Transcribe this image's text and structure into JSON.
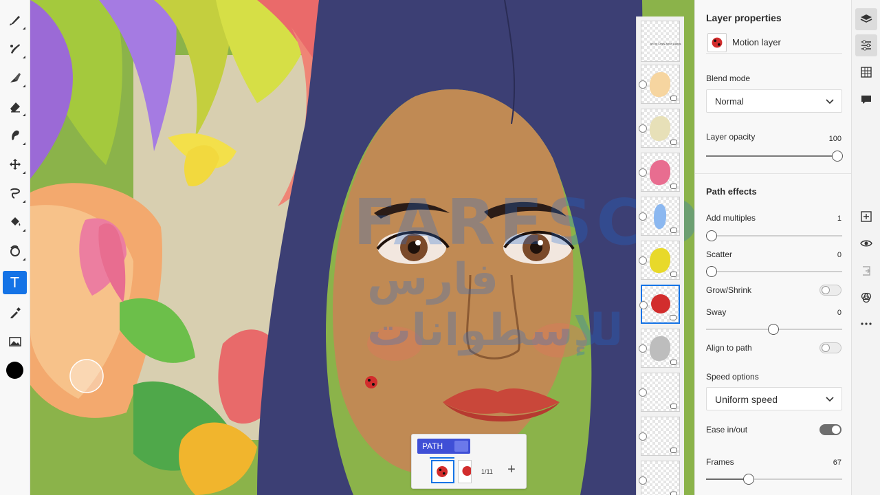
{
  "toolbar": {
    "tools": [
      {
        "name": "pixel-brush-icon"
      },
      {
        "name": "live-brush-icon"
      },
      {
        "name": "vector-brush-icon"
      },
      {
        "name": "eraser-icon"
      },
      {
        "name": "smudge-icon"
      },
      {
        "name": "move-icon"
      },
      {
        "name": "lasso-icon"
      },
      {
        "name": "fill-icon"
      },
      {
        "name": "liquify-icon"
      },
      {
        "name": "text-icon",
        "active": true,
        "glyph": "T"
      },
      {
        "name": "eyedropper-icon"
      },
      {
        "name": "image-icon"
      }
    ],
    "color": "#000000"
  },
  "watermark": {
    "latin": "FARESCD",
    "arabic": "فارس للإسطوانات"
  },
  "frames": {
    "title_text": "Art by Cristy Anne Lignos",
    "count": 11,
    "selected_index": 6
  },
  "path_panel": {
    "tag_label": "PATH",
    "counter": "1/11",
    "add_label": "+"
  },
  "properties": {
    "title": "Layer properties",
    "layer_name": "Motion layer",
    "blend_mode_label": "Blend mode",
    "blend_mode_value": "Normal",
    "opacity_label": "Layer opacity",
    "opacity_value": "100",
    "path_effects_title": "Path effects",
    "add_multiples_label": "Add multiples",
    "add_multiples_value": "1",
    "scatter_label": "Scatter",
    "scatter_value": "0",
    "grow_shrink_label": "Grow/Shrink",
    "grow_shrink_on": false,
    "sway_label": "Sway",
    "sway_value": "0",
    "align_to_path_label": "Align to path",
    "align_to_path_on": false,
    "speed_options_label": "Speed options",
    "speed_options_value": "Uniform speed",
    "ease_label": "Ease in/out",
    "ease_on": true,
    "frames_label": "Frames",
    "frames_value": "67"
  },
  "rail": {
    "buttons": [
      "layers-icon",
      "properties-icon",
      "grid-icon",
      "comment-icon",
      "add-layer-icon",
      "visibility-icon",
      "merge-icon",
      "blend-icon",
      "more-icon"
    ]
  },
  "colors": {
    "accent": "#1473e6",
    "path_tag": "#3f4fd6"
  }
}
